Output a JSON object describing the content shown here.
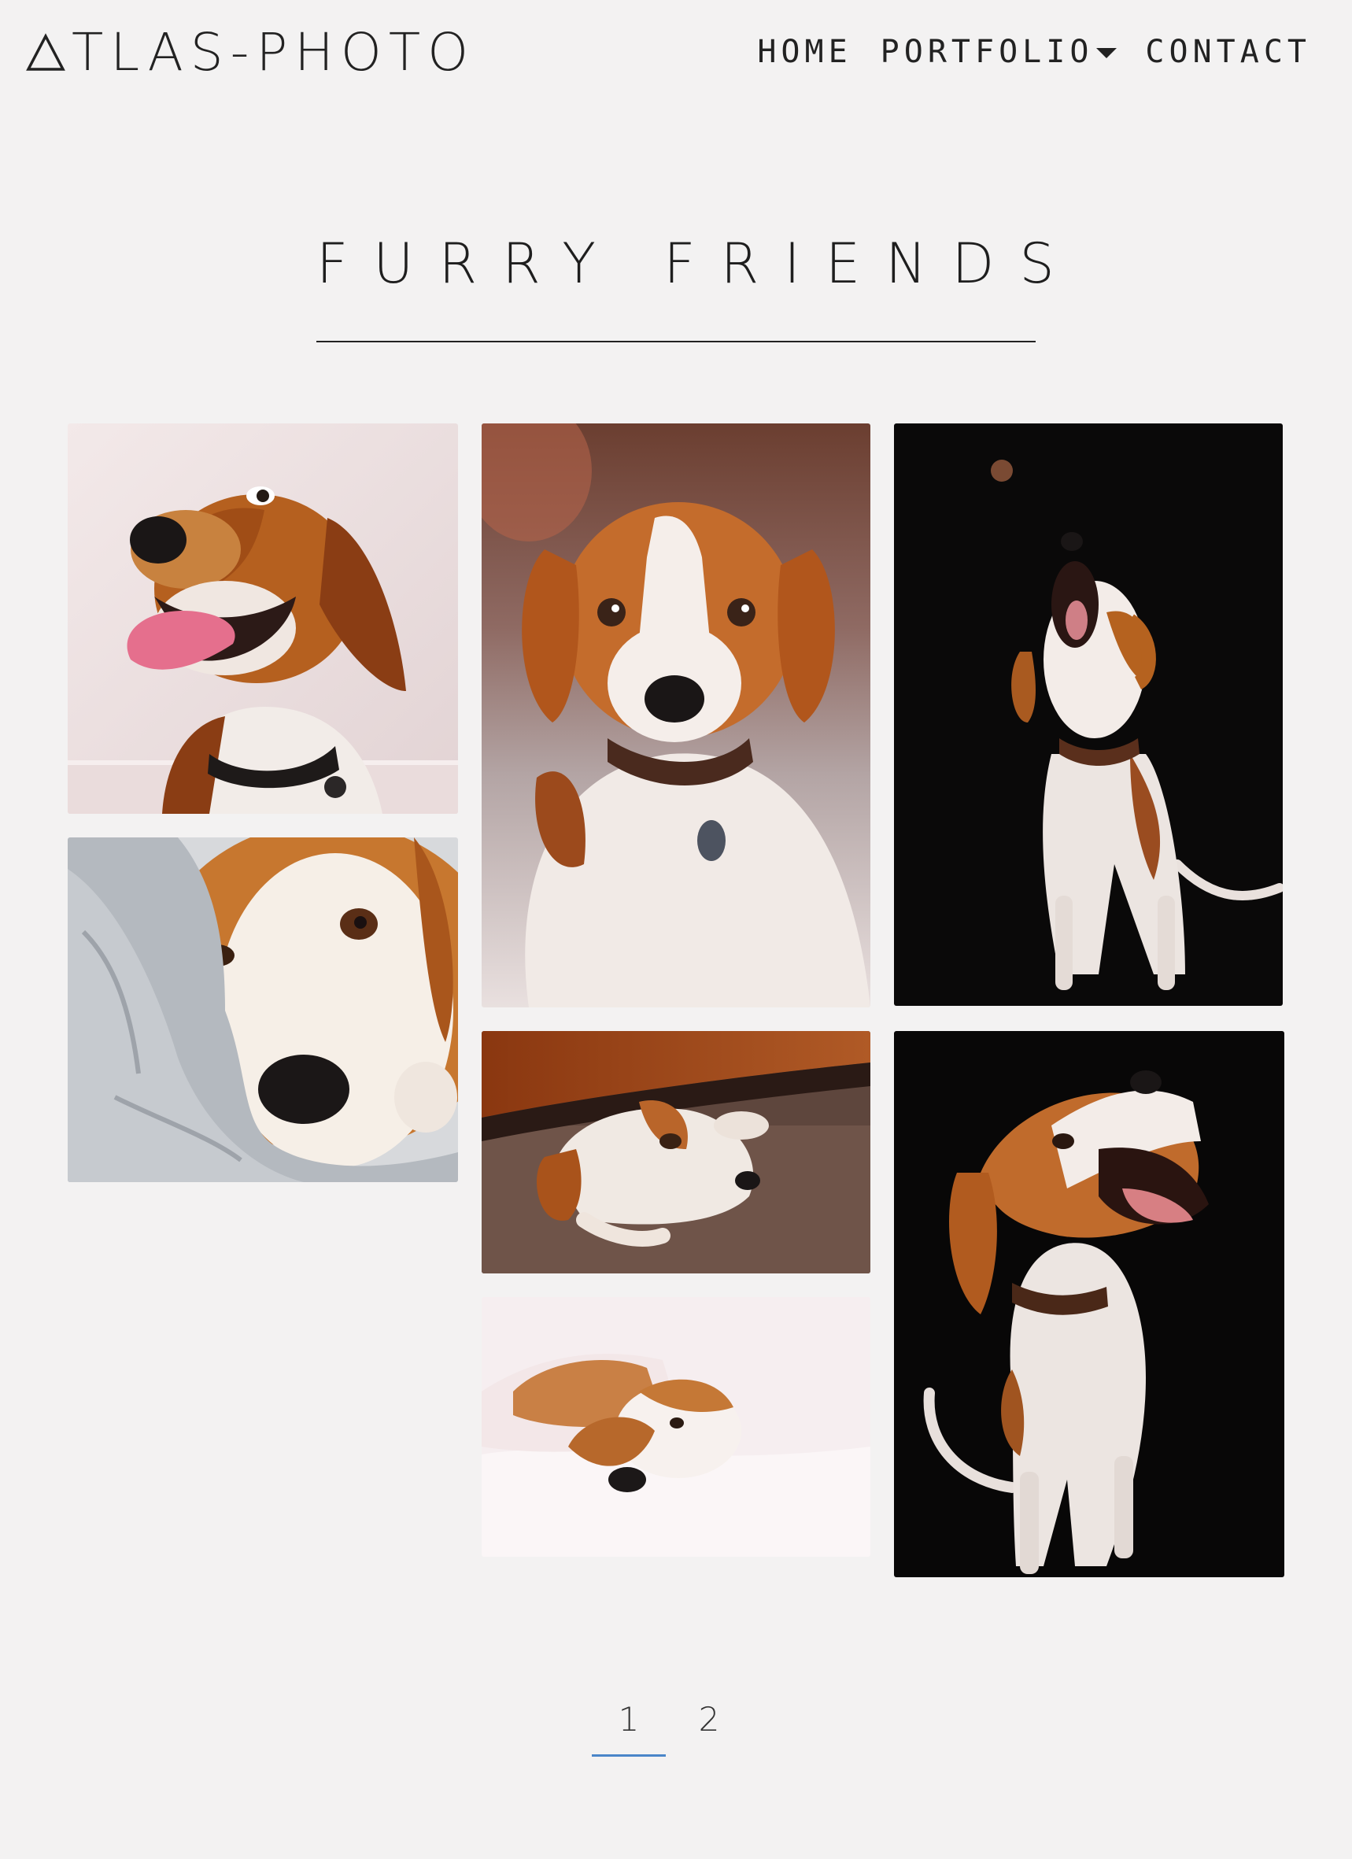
{
  "header": {
    "logo_text": "TLAS-PHOTO",
    "logo_icon": "triangle-icon",
    "nav": {
      "home": "HOME",
      "portfolio": "PORTFOLIO",
      "contact": "CONTACT"
    }
  },
  "page": {
    "title": "FURRY FRIENDS"
  },
  "gallery": {
    "photos": [
      "beagle-smiling-tongue-out",
      "beagle-lying-on-bed",
      "beagle-catching-treat-black-background",
      "beagle-under-blanket",
      "beagle-under-furniture-on-carpet",
      "beagle-lying-on-white-sheets",
      "beagle-barking-black-background"
    ]
  },
  "pagination": {
    "pages": [
      "1",
      "2"
    ],
    "current": "1"
  },
  "colors": {
    "background": "#f3f2f2",
    "text": "#1e1e1e",
    "pagination_active": "#4a86c8"
  }
}
